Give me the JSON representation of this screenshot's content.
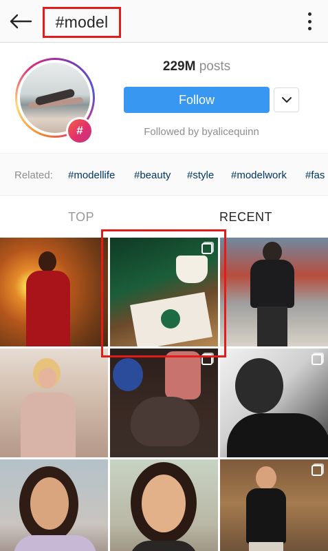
{
  "topbar": {
    "back_icon": "arrow-left-icon",
    "title": "#model",
    "menu_icon": "more-vertical-icon",
    "highlight_color": "#e21b1b"
  },
  "header": {
    "avatar_badge": "#",
    "posts_count": "229M",
    "posts_label": "posts",
    "follow_label": "Follow",
    "dropdown_icon": "chevron-down-icon",
    "followed_by": "Followed by byalicequinn",
    "accent_color": "#3897f0"
  },
  "related": {
    "label": "Related:",
    "tags": [
      "#modellife",
      "#beauty",
      "#style",
      "#modelwork",
      "#fas"
    ]
  },
  "tabs": {
    "top": "TOP",
    "recent": "RECENT",
    "active": "RECENT"
  },
  "grid": {
    "posts": [
      {
        "subject": "man in red jacket at sunset",
        "multi": false
      },
      {
        "subject": "starbucks coffee cup and bag",
        "multi": true
      },
      {
        "subject": "man in black hoodie on stairs",
        "multi": false
      },
      {
        "subject": "blonde woman in floral dress",
        "multi": false
      },
      {
        "subject": "mask and plush toys",
        "multi": true
      },
      {
        "subject": "black and white portrait of man",
        "multi": true
      },
      {
        "subject": "smiling woman portrait",
        "multi": false
      },
      {
        "subject": "smiling young woman",
        "multi": false
      },
      {
        "subject": "man in black shirt on street",
        "multi": true
      }
    ]
  }
}
